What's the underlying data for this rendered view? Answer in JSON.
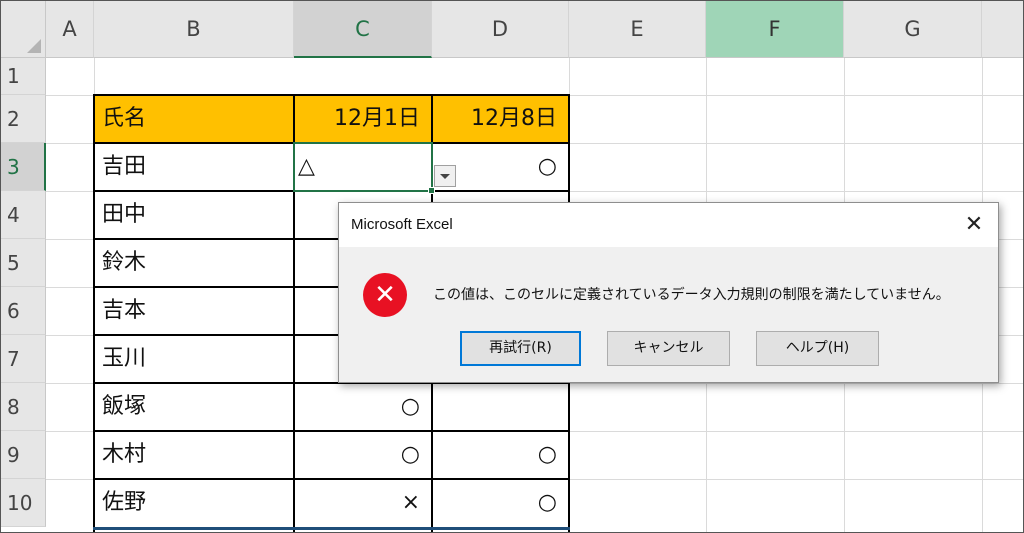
{
  "columns": [
    "A",
    "B",
    "C",
    "D",
    "E",
    "F",
    "G"
  ],
  "rows": [
    "1",
    "2",
    "3",
    "4",
    "5",
    "6",
    "7",
    "8",
    "9",
    "10"
  ],
  "table": {
    "header": {
      "name": "氏名",
      "date1": "12月1日",
      "date2": "12月8日"
    },
    "names": [
      "吉田",
      "田中",
      "鈴木",
      "吉本",
      "玉川",
      "飯塚",
      "木村",
      "佐野"
    ],
    "c_values": [
      "△",
      "",
      "",
      "",
      "",
      "○",
      "○",
      "×"
    ],
    "d_values": [
      "○",
      "",
      "",
      "",
      "",
      "",
      "○",
      "○"
    ]
  },
  "dialog": {
    "title": "Microsoft Excel",
    "close_glyph": "✕",
    "error_glyph": "✕",
    "message": "この値は、このセルに定義されているデータ入力規則の制限を満たしていません。",
    "buttons": {
      "retry": "再試行(R)",
      "cancel": "キャンセル",
      "help": "ヘルプ(H)"
    }
  },
  "colors": {
    "header_fill": "#ffc000",
    "selection": "#217346",
    "error": "#e81123"
  }
}
